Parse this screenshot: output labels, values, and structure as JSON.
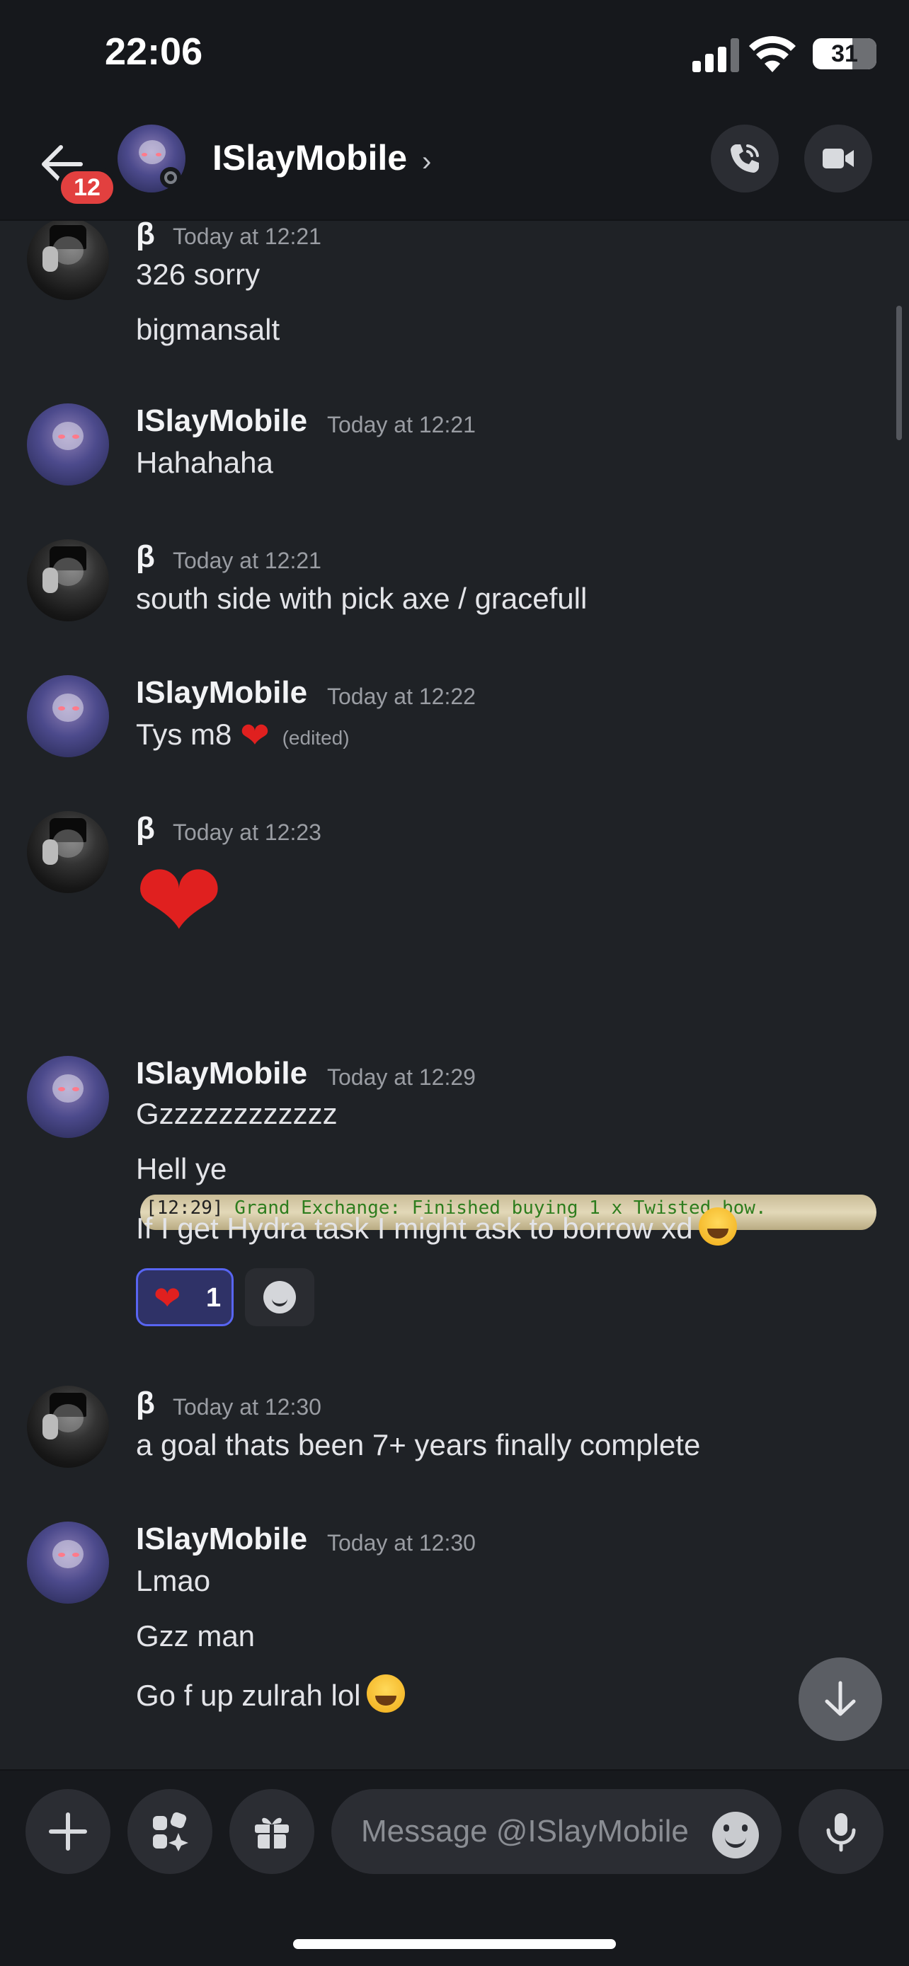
{
  "status_bar": {
    "time": "22:06",
    "battery": "31"
  },
  "header": {
    "title": "ISlayMobile",
    "chevron": "›",
    "unread_count": "12"
  },
  "messages": [
    {
      "author": "β",
      "timestamp": "Today at 12:21",
      "lines": [
        "326 sorry",
        "bigmansalt"
      ]
    },
    {
      "author": "ISlayMobile",
      "timestamp": "Today at 12:21",
      "lines": [
        "Hahahaha"
      ]
    },
    {
      "author": "β",
      "timestamp": "Today at 12:21",
      "lines": [
        "south side with pick axe / gracefull"
      ]
    },
    {
      "author": "ISlayMobile",
      "timestamp": "Today at 12:22",
      "lines": [
        "Tys m8"
      ],
      "edited_label": "(edited)"
    },
    {
      "author": "β",
      "timestamp": "Today at 12:23",
      "big_emoji": "❤",
      "attachment": {
        "time_text": "[12:29]",
        "text": "Grand Exchange: Finished buying 1 x Twisted bow."
      }
    },
    {
      "author": "ISlayMobile",
      "timestamp": "Today at 12:29",
      "lines": [
        "Gzzzzzzzzzzzz",
        "Hell ye",
        "If I get Hydra task I might ask to borrow xd"
      ],
      "reaction": {
        "emoji": "❤",
        "count": "1"
      }
    },
    {
      "author": "β",
      "timestamp": "Today at 12:30",
      "lines": [
        "a goal thats been 7+ years finally complete"
      ]
    },
    {
      "author": "ISlayMobile",
      "timestamp": "Today at 12:30",
      "lines": [
        "Lmao",
        "Gzz man",
        "Go f up zulrah lol"
      ]
    }
  ],
  "composer": {
    "placeholder": "Message @ISlayMobile"
  },
  "colors": {
    "accent": "#5865f2",
    "badge_red": "#e2403f",
    "background": "#1f2226",
    "header": "#16181c"
  },
  "icons": [
    "back-arrow-icon",
    "phone-call-icon",
    "video-camera-icon",
    "plus-icon",
    "apps-icon",
    "gift-icon",
    "emoji-icon",
    "microphone-icon",
    "arrow-down-icon"
  ]
}
